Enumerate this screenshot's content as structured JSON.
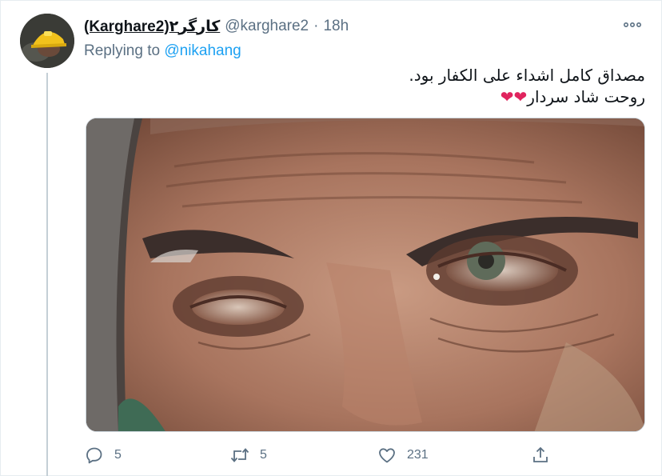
{
  "tweet": {
    "display_name": "(Karghare2)کارگر۲",
    "handle": "@karghare2",
    "separator": "·",
    "timestamp": "18h",
    "reply_prefix": "Replying to ",
    "reply_handle": "@nikahang",
    "text_line_1": "مصداق کامل اشداء علی الکفار بود.",
    "text_line_2": "روحت شاد سردار",
    "text_line_2_emoji": "❤❤",
    "media_alt": "close-up photo of a man's eyes"
  },
  "actions": {
    "reply_count": "5",
    "retweet_count": "5",
    "like_count": "231"
  },
  "colors": {
    "accent": "#1da1f2",
    "muted": "#5b7083",
    "heart": "#e0245e",
    "border": "#e6ecf0"
  }
}
